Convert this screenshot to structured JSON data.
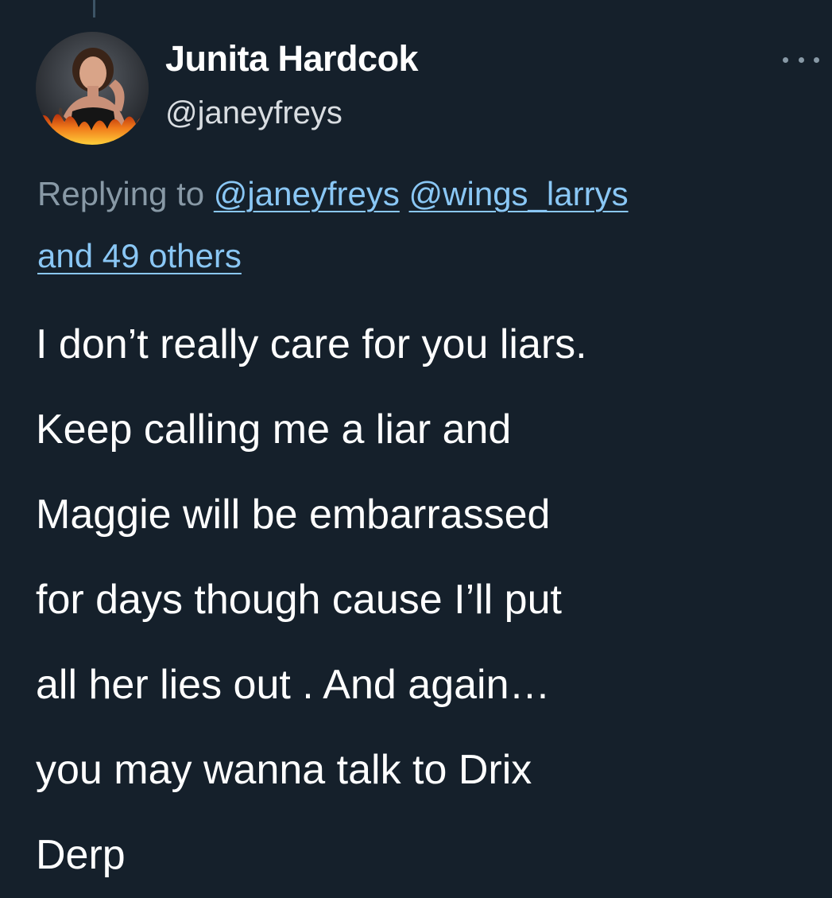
{
  "tweet": {
    "author": {
      "display_name": "Junita Hardcok",
      "handle": "@janeyfreys",
      "avatar_icon": "profile-avatar"
    },
    "menu_icon": "more-options-icon",
    "reply_context": {
      "prefix": "Replying to",
      "mentions": [
        "@janeyfreys",
        "@wings_larrys"
      ],
      "others": "and 49 others"
    },
    "text_lines": [
      "I don’t really care for you liars.",
      "Keep calling me a liar and",
      "Maggie will be embarrassed",
      "for days though cause I’ll put",
      "all her lies out . And again…",
      "you may wanna talk to Drix",
      "Derp"
    ]
  },
  "colors": {
    "background": "#15202b",
    "link": "#8ac7f5",
    "secondary_text": "#8899a6",
    "primary_text": "#ffffff"
  }
}
